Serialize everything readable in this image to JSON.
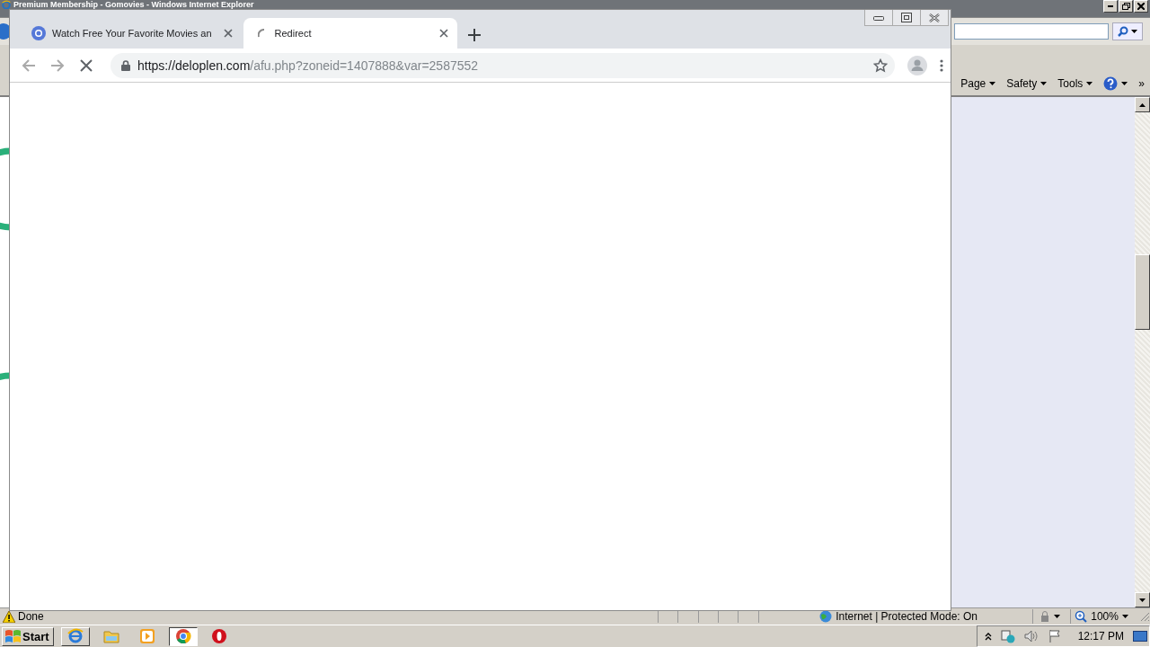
{
  "ie_window": {
    "title": "Premium Membership - Gomovies - Windows Internet Explorer",
    "command_bar": [
      {
        "label": "Page"
      },
      {
        "label": "Safety"
      },
      {
        "label": "Tools"
      }
    ],
    "overflow": "»",
    "status_bar": {
      "status": "Done",
      "zone": "Internet | Protected Mode: On",
      "zoom": "100%"
    }
  },
  "chrome_window": {
    "tabs": [
      {
        "title": "Watch Free Your Favorite Movies an",
        "selected": false,
        "loading": false
      },
      {
        "title": "Redirect",
        "selected": true,
        "loading": true
      }
    ],
    "address": {
      "host": "https://deloplen.com",
      "path": "/afu.php?zoneid=1407888&var=2587552"
    }
  },
  "taskbar": {
    "start": "Start",
    "apps": [
      {
        "kind": "ie",
        "selected": false
      },
      {
        "kind": "folder",
        "selected": false
      },
      {
        "kind": "media",
        "selected": false
      },
      {
        "kind": "chrome",
        "selected": true
      },
      {
        "kind": "opera",
        "selected": false
      }
    ],
    "clock": "12:17 PM"
  }
}
